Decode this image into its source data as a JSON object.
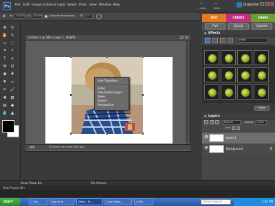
{
  "menubar": {
    "items": [
      "File",
      "Edit",
      "Image",
      "Enhance",
      "Layer",
      "Select",
      "Filter",
      "View",
      "Window",
      "Help"
    ],
    "undo": "Undo",
    "redo": "Redo",
    "organizer": "Organizer"
  },
  "options": {
    "w_label": "W:",
    "w_value": "100.0%",
    "h_label": "H:",
    "h_value": "100.0%",
    "constrain": "Constrain Proportions",
    "angle_value": "0.0"
  },
  "modes": {
    "edit": "EDIT",
    "create": "CREATE",
    "share": "SHARE",
    "full": "Full",
    "quick": "Quick",
    "guided": "Guided",
    "colors": {
      "edit": "#e37a21",
      "create": "#c42e7e",
      "share": "#69a02e"
    }
  },
  "document": {
    "title": "Untitled-1 @ 28% (Layer 1, RGB/8)",
    "zoom": "28%",
    "status": "8 inches x 8 inches (300 ppi)"
  },
  "context_menu": {
    "items": [
      "Free Transform",
      "Scale",
      "Free Rotate Layer",
      "Skew",
      "Distort",
      "Perspective"
    ]
  },
  "effects": {
    "title": "Effects",
    "category": "Artistic",
    "apply_label": "Apply"
  },
  "layers": {
    "title": "Layers",
    "blend_mode": "Normal",
    "opacity_label": "Opacity:",
    "opacity_value": "100%",
    "lock_label": "Lock:",
    "rows": [
      {
        "name": "Layer 1"
      },
      {
        "name": "Background"
      }
    ]
  },
  "bottom": {
    "project_bin": "Show Photo Bin",
    "bin_actions": "Bin Actions",
    "hide_bin": "Hide Project Bin"
  },
  "taskbar": {
    "start": "start",
    "tasks": [
      "2 Win...",
      "How to Tu...",
      "Editor - M...",
      "Cram Mono...",
      "2 Win..."
    ],
    "search_placeholder": "Yahoo! Search",
    "clock": "2:45 PM"
  }
}
